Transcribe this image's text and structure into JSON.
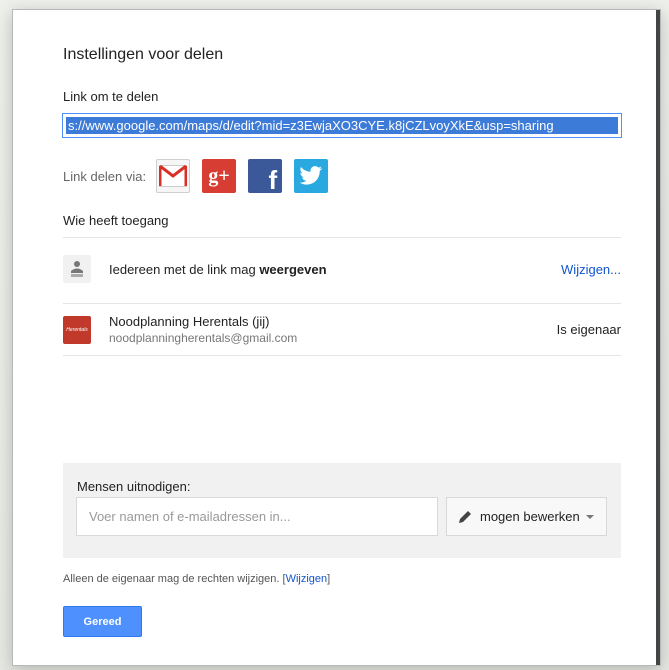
{
  "dialog": {
    "title": "Instellingen voor delen",
    "link_section_label": "Link om te delen",
    "share_link_value": "s://www.google.com/maps/d/edit?mid=z3EwjaXO3CYE.k8jCZLvoyXkE&usp=sharing",
    "share_via_label": "Link delen via:",
    "share_services": [
      {
        "name": "Gmail",
        "icon": "gmail-icon",
        "color": "#d93025"
      },
      {
        "name": "Google+",
        "icon": "google-plus-icon",
        "glyph": "g+",
        "color": "#d73d32"
      },
      {
        "name": "Facebook",
        "icon": "facebook-icon",
        "glyph": "f",
        "color": "#3b5998"
      },
      {
        "name": "Twitter",
        "icon": "twitter-icon",
        "color": "#2aa8e0"
      }
    ],
    "access_section_label": "Wie heeft toegang",
    "access_entries": [
      {
        "icon": "people-icon",
        "text_prefix": "Iedereen met de link mag ",
        "text_strong": "weergeven",
        "action": "Wijzigen..."
      },
      {
        "icon": "herentals-logo-icon",
        "logo_text": "Herentals",
        "name": "Noodplanning Herentals (jij)",
        "email": "noodplanningherentals@gmail.com",
        "role": "Is eigenaar"
      }
    ],
    "invite": {
      "label": "Mensen uitnodigen:",
      "placeholder": "Voer namen of e-mailadressen in...",
      "permission_label": "mogen bewerken",
      "permission_icon": "pencil-icon"
    },
    "footer_note_prefix": "Alleen de eigenaar mag de rechten wijzigen. ",
    "footer_note_link_open": "[",
    "footer_note_link_text": "Wijzigen",
    "footer_note_link_close": "]",
    "done_button_label": "Gereed"
  },
  "colors": {
    "primary_button": "#4d90fe",
    "link": "#1155cc",
    "selection": "#3d7bd8",
    "brand_red": "#c0392b"
  }
}
